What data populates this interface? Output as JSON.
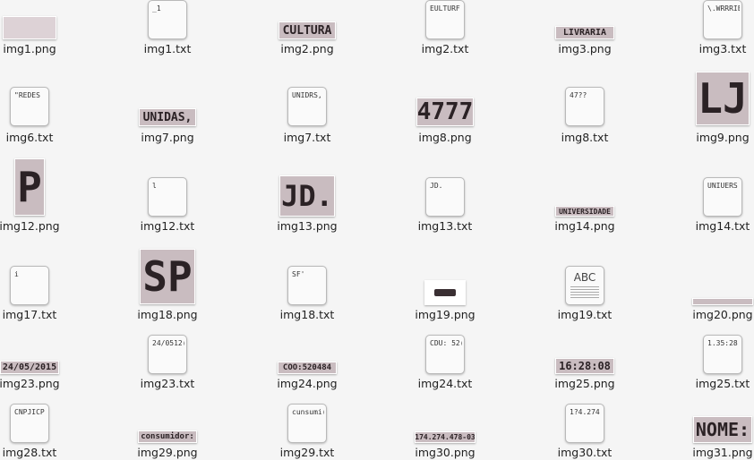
{
  "files": {
    "img1_png": {
      "name": "img1.png"
    },
    "img1_txt": {
      "name": "img1.txt",
      "preview": "_1"
    },
    "img2_png": {
      "name": "img2.png",
      "text": "CULTURA"
    },
    "img2_txt": {
      "name": "img2.txt",
      "preview": "EULTURF"
    },
    "img3_png": {
      "name": "img3.png",
      "text": "LIVRARIA"
    },
    "img3_txt": {
      "name": "img3.txt",
      "preview": "\\.WRRRIE"
    },
    "img6_txt": {
      "name": "img6.txt",
      "preview": "\"REDES"
    },
    "img7_png": {
      "name": "img7.png",
      "text": "UNIDAS,"
    },
    "img7_txt": {
      "name": "img7.txt",
      "preview": "UNIDRS,"
    },
    "img8_png": {
      "name": "img8.png",
      "text": "4777"
    },
    "img8_txt": {
      "name": "img8.txt",
      "preview": "47??"
    },
    "img9_png": {
      "name": "img9.png",
      "text": "LJ"
    },
    "img12_png": {
      "name": "img12.png",
      "text": "P"
    },
    "img12_txt": {
      "name": "img12.txt",
      "preview": "l"
    },
    "img13_png": {
      "name": "img13.png",
      "text": "JD."
    },
    "img13_txt": {
      "name": "img13.txt",
      "preview": "JD."
    },
    "img14_png": {
      "name": "img14.png",
      "text": "UNIVERSIDADE"
    },
    "img14_txt": {
      "name": "img14.txt",
      "preview": "UNIUERS"
    },
    "img17_txt": {
      "name": "img17.txt",
      "preview": "i"
    },
    "img18_png": {
      "name": "img18.png",
      "text": "SP"
    },
    "img18_txt": {
      "name": "img18.txt",
      "preview": "SF'"
    },
    "img19_png": {
      "name": "img19.png"
    },
    "img19_txt": {
      "name": "img19.txt",
      "preview": "ABC"
    },
    "img20_png": {
      "name": "img20.png"
    },
    "img23_png": {
      "name": "img23.png",
      "text": "24/05/2015"
    },
    "img23_txt": {
      "name": "img23.txt",
      "preview": "24/0512("
    },
    "img24_png": {
      "name": "img24.png",
      "text": "COO:520484"
    },
    "img24_txt": {
      "name": "img24.txt",
      "preview": "CDU: 52("
    },
    "img25_png": {
      "name": "img25.png",
      "text": "16:28:08"
    },
    "img25_txt": {
      "name": "img25.txt",
      "preview": "1.35:28"
    },
    "img28_txt": {
      "name": "img28.txt",
      "preview": "CNPJICP"
    },
    "img29_png": {
      "name": "img29.png",
      "text": "consumidor:"
    },
    "img29_txt": {
      "name": "img29.txt",
      "preview": "cunsumi("
    },
    "img30_png": {
      "name": "img30.png",
      "text": "174.274.478-03"
    },
    "img30_txt": {
      "name": "img30.txt",
      "preview": "1?4.274"
    },
    "img31_png": {
      "name": "img31.png",
      "text": "NOME:"
    }
  }
}
